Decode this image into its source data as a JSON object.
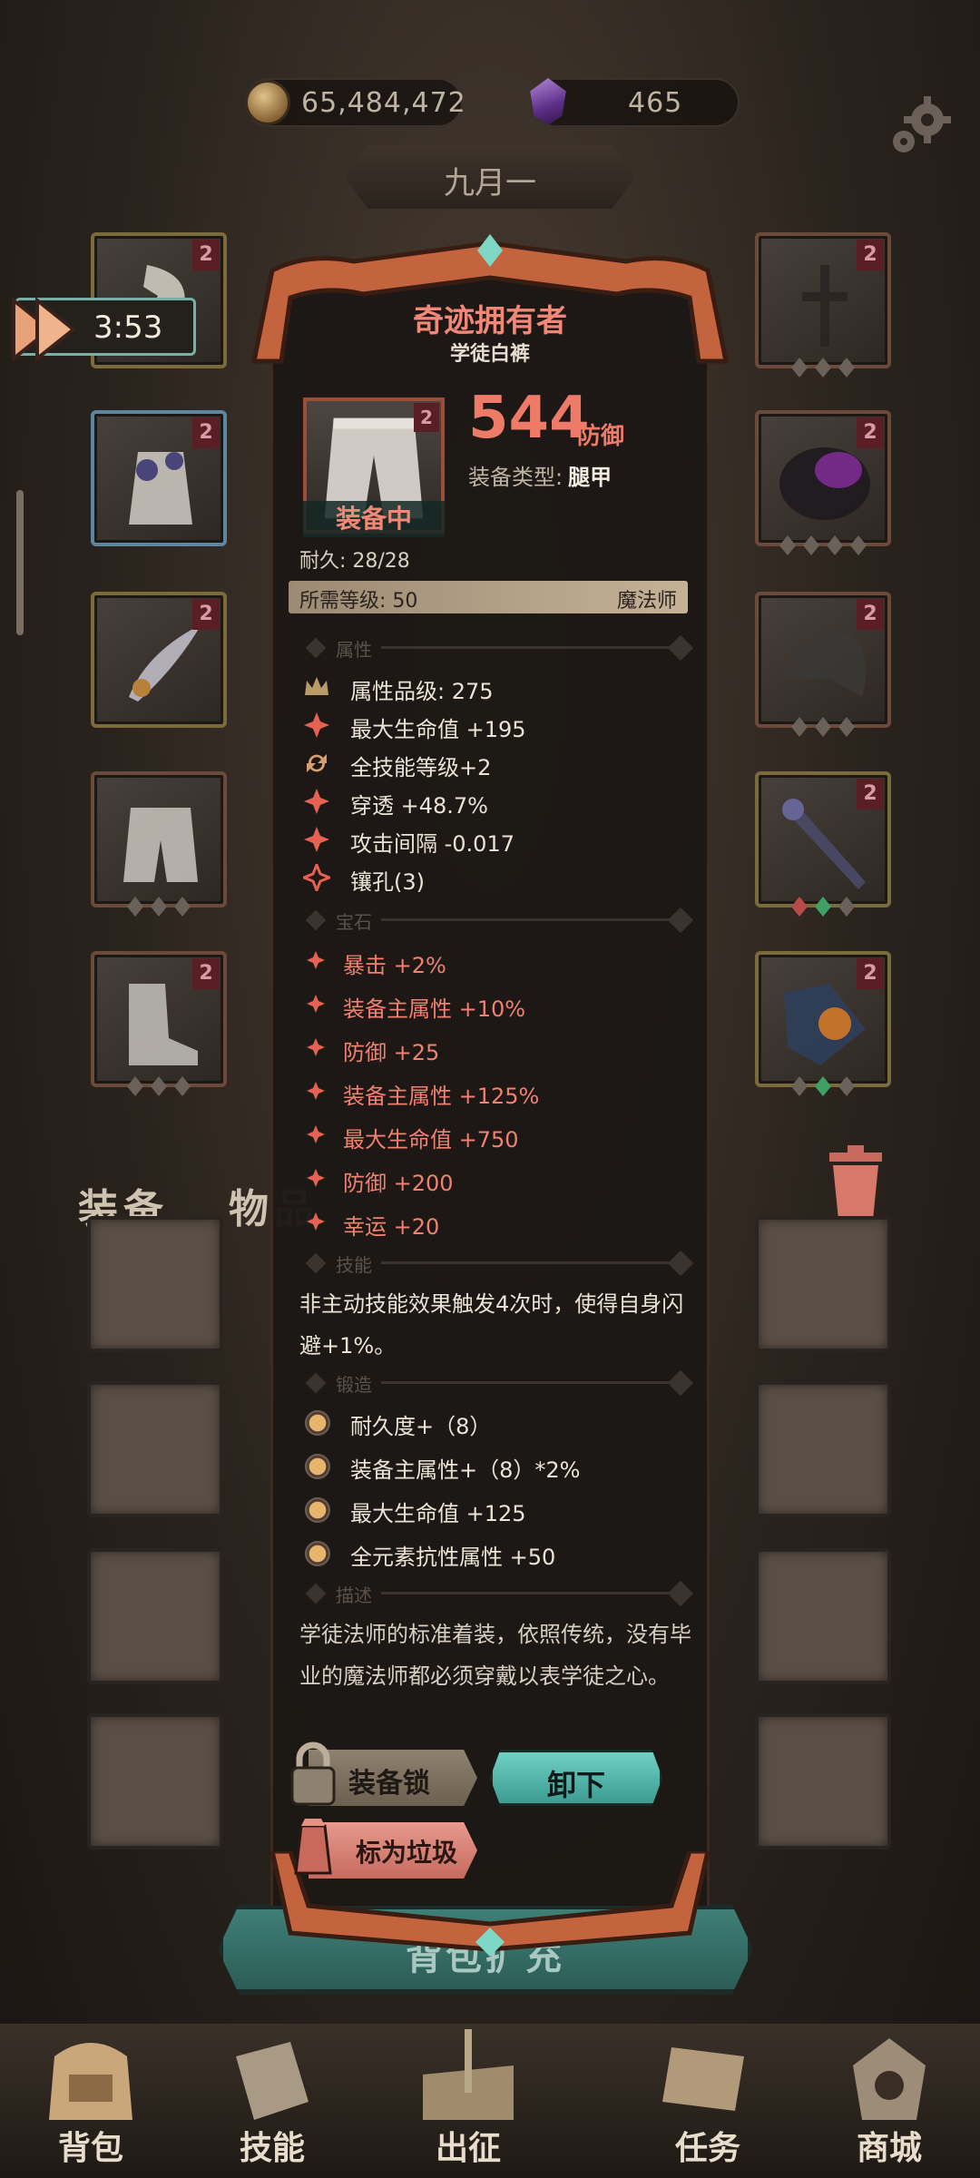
{
  "topbar": {
    "gold": "65,484,472",
    "gems": "465",
    "month": "九月一",
    "timer": "3:53",
    "icons": {
      "gold": "coin-icon",
      "gems": "gem-icon",
      "settings": "gear-icon"
    }
  },
  "slots": {
    "left": [
      {
        "name": "slot-left-1",
        "level": "2",
        "item": "axe"
      },
      {
        "name": "slot-left-2",
        "level": "2",
        "item": "flower-robe"
      },
      {
        "name": "slot-left-3",
        "level": "2",
        "item": "feather-charm"
      },
      {
        "name": "slot-left-4",
        "level": "",
        "item": "pants"
      },
      {
        "name": "slot-left-5",
        "level": "2",
        "item": "boots"
      }
    ],
    "right": [
      {
        "name": "slot-right-1",
        "level": "2",
        "item": "cross-necklace"
      },
      {
        "name": "slot-right-2",
        "level": "2",
        "item": "dark-armor"
      },
      {
        "name": "slot-right-3",
        "level": "2",
        "item": "helmet"
      },
      {
        "name": "slot-right-4",
        "level": "2",
        "item": "staff"
      },
      {
        "name": "slot-right-5",
        "level": "2",
        "item": "orb-shield"
      }
    ]
  },
  "tabs": {
    "equipment": "装备",
    "items": "物品"
  },
  "expand_label": "背包扩充",
  "nav": [
    {
      "label": "背包",
      "icon": "backpack-icon"
    },
    {
      "label": "技能",
      "icon": "skill-book-icon"
    },
    {
      "label": "出征",
      "icon": "map-sword-icon"
    },
    {
      "label": "任务",
      "icon": "scroll-icon"
    },
    {
      "label": "商城",
      "icon": "shop-icon"
    }
  ],
  "detail": {
    "title": "奇迹拥有者",
    "subtitle": "学徒白裤",
    "level_badge": "2",
    "equipped": "装备中",
    "value": "544",
    "value_unit": "防御",
    "type_label": "装备类型:",
    "type_value": "腿甲",
    "durability": "耐久: 28/28",
    "required_level": "所需等级: 50",
    "class": "魔法师",
    "section_attributes": "属性",
    "attributes": [
      {
        "icon": "crown-icon",
        "text": "属性品级: 275"
      },
      {
        "icon": "red-star-icon",
        "text": "最大生命值 +195"
      },
      {
        "icon": "refresh-icon",
        "text": "全技能等级+2"
      },
      {
        "icon": "red-star-icon",
        "text": "穿透 +48.7%"
      },
      {
        "icon": "red-star-icon",
        "text": "攻击间隔 -0.017"
      },
      {
        "icon": "socket-icon",
        "text": "镶孔(3)"
      }
    ],
    "section_gems": "宝石",
    "gems": [
      "暴击 +2%",
      "装备主属性 +10%",
      "防御 +25",
      "装备主属性 +125%",
      "最大生命值 +750",
      "防御 +200",
      "幸运 +20"
    ],
    "section_skill": "技能",
    "skill_text": "非主动技能效果触发4次时，使得自身闪避+1%。",
    "section_forge": "锻造",
    "forge": [
      "耐久度+（8）",
      "装备主属性+（8）*2%",
      "最大生命值 +125",
      "全元素抗性属性 +50"
    ],
    "section_desc": "描述",
    "description": "学徒法师的标准着装，依照传统，没有毕业的魔法师都必须穿戴以表学徒之心。",
    "buttons": {
      "lock": "装备锁",
      "unequip": "卸下",
      "junk": "标为垃圾"
    }
  },
  "colors": {
    "accent_red": "#ee7a68",
    "teal": "#6fd0c5",
    "gold": "#e9b56e"
  }
}
